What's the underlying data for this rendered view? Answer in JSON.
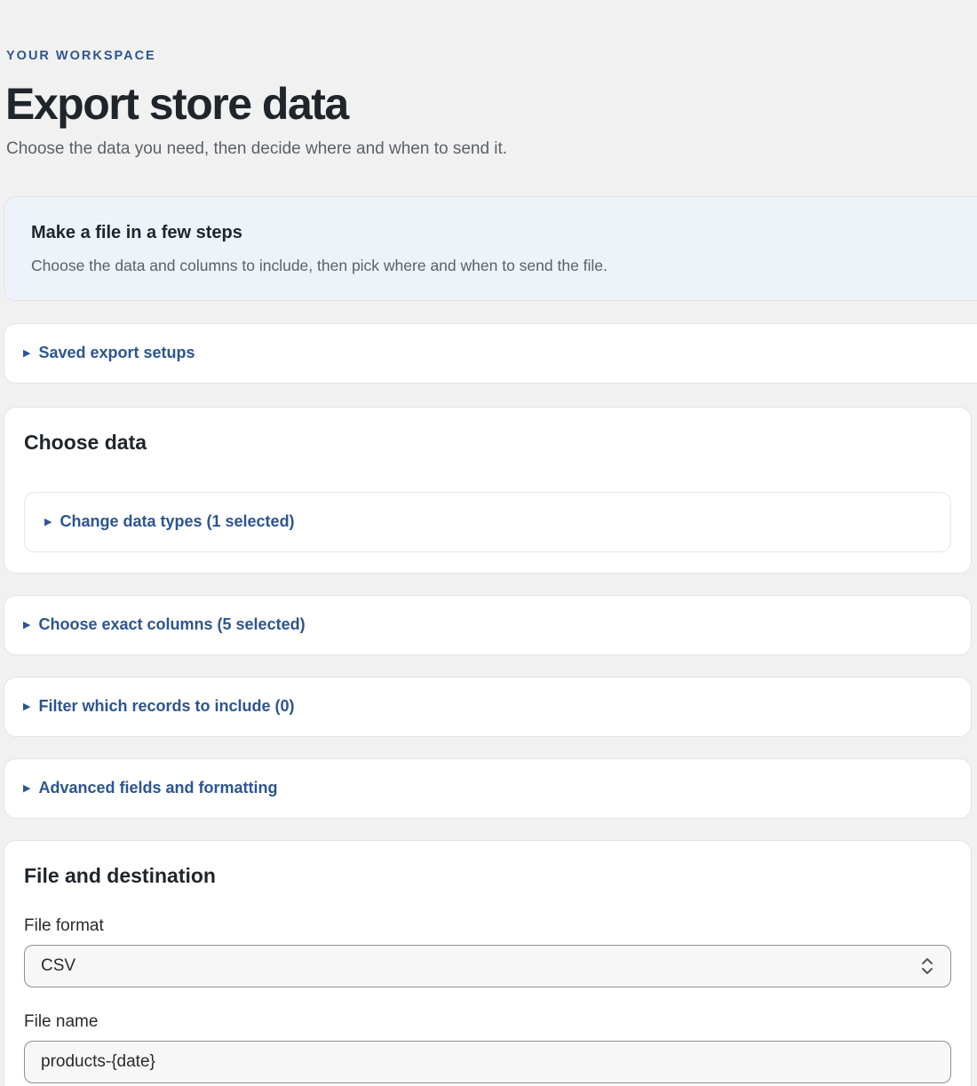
{
  "header": {
    "eyebrow": "YOUR WORKSPACE",
    "title": "Export store data",
    "subtitle": "Choose the data you need, then decide where and when to send it."
  },
  "banner": {
    "title": "Make a file in a few steps",
    "text": "Choose the data and columns to include, then pick where and when to send the file."
  },
  "saved_setups": {
    "label": "Saved export setups"
  },
  "choose_data": {
    "title": "Choose data",
    "data_types_label": "Change data types (1 selected)"
  },
  "columns": {
    "label": "Choose exact columns (5 selected)"
  },
  "filters": {
    "label": "Filter which records to include (0)"
  },
  "advanced": {
    "label": "Advanced fields and formatting"
  },
  "file_destination": {
    "title": "File and destination",
    "format_label": "File format",
    "format_value": "CSV",
    "name_label": "File name",
    "name_value": "products-{date}"
  },
  "icons": {
    "disclosure": "triangle-right-icon",
    "select": "chevron-up-down-icon"
  },
  "colors": {
    "accent": "#2c5592",
    "background": "#f1f1f1",
    "banner": "#eef3fa"
  }
}
